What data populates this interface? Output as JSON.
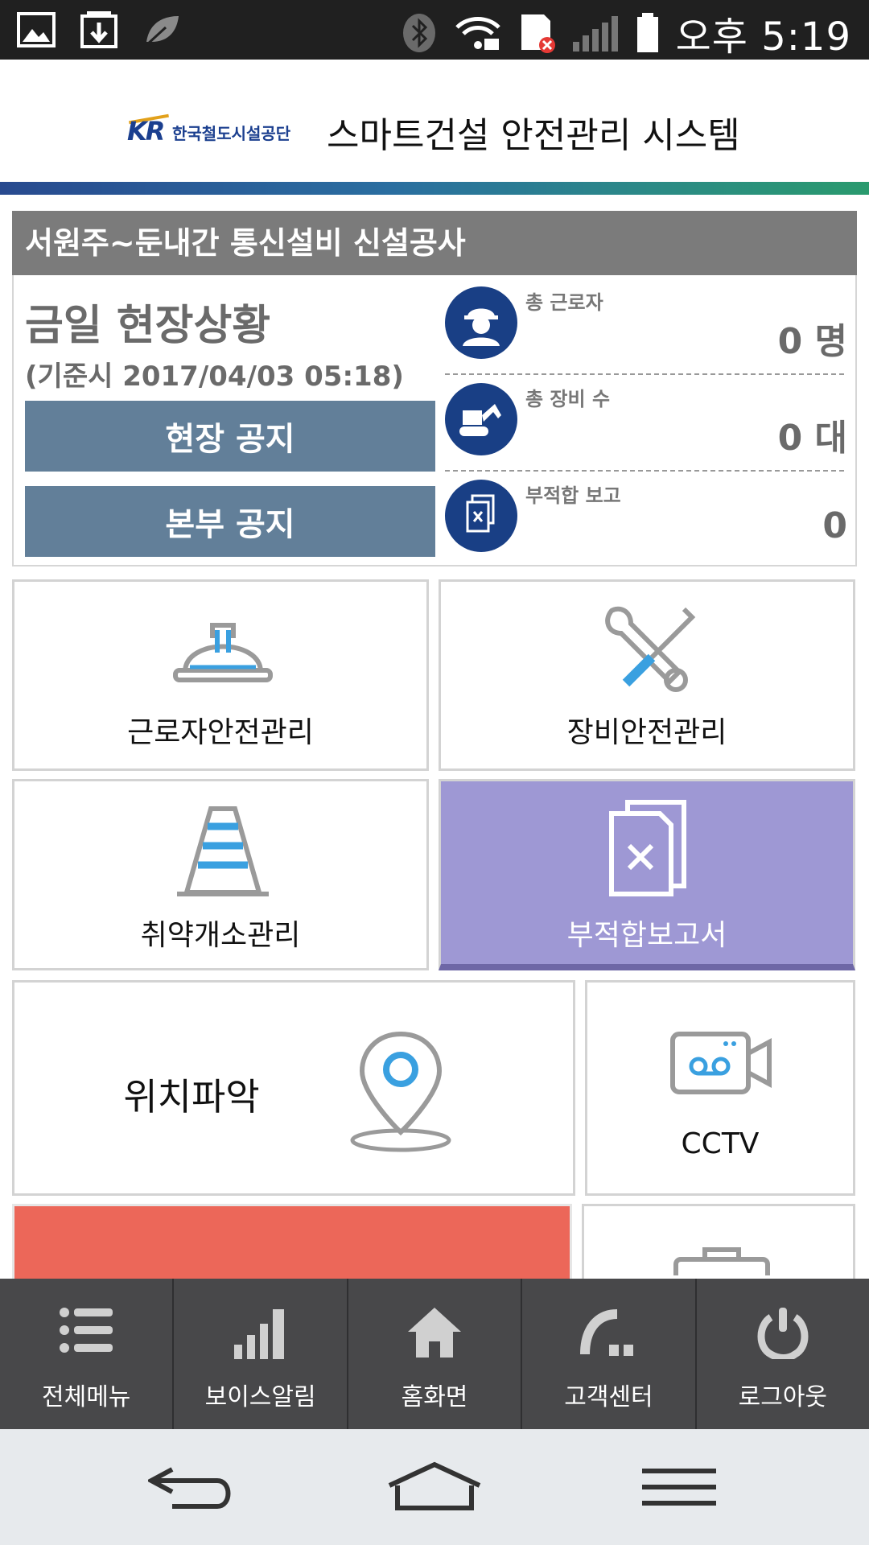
{
  "status_bar": {
    "time": "오후 5:19",
    "icons": [
      "gallery-icon",
      "download-icon",
      "leaf-icon",
      "bluetooth-icon",
      "wifi-lock-icon",
      "sim-error-icon",
      "signal-icon",
      "battery-icon"
    ]
  },
  "header": {
    "logo_text": "한국철도시설공단",
    "logo_mark": "KR",
    "title": "스마트건설 안전관리 시스템"
  },
  "site": {
    "name": "서원주~둔내간 통신설비 신설공사"
  },
  "today": {
    "title": "금일 현장상황",
    "timestamp": "(기준시 2017/04/03 05:18)",
    "site_notice_label": "현장 공지",
    "hq_notice_label": "본부 공지"
  },
  "stats": [
    {
      "label": "총 근로자",
      "value": "0 명",
      "icon": "worker-icon"
    },
    {
      "label": "총 장비 수",
      "value": "0 대",
      "icon": "excavator-icon"
    },
    {
      "label": "부적합 보고",
      "value": "0",
      "icon": "document-x-icon"
    }
  ],
  "tiles": {
    "worker_safety": "근로자안전관리",
    "equipment_safety": "장비안전관리",
    "vulnerable_area": "취약개소관리",
    "nonconformity_report": "부적합보고서",
    "location": "위치파악",
    "cctv": "CCTV"
  },
  "colors": {
    "accent_purple": "#9e98d4",
    "navy": "#193f85",
    "notice_button": "#627f99",
    "red_tile": "#ec6759",
    "nav_bg": "#48484a"
  },
  "bottom_nav": [
    {
      "label": "전체메뉴",
      "icon": "list-icon"
    },
    {
      "label": "보이스알림",
      "icon": "bars-icon"
    },
    {
      "label": "홈화면",
      "icon": "home-icon"
    },
    {
      "label": "고객센터",
      "icon": "headset-icon"
    },
    {
      "label": "로그아웃",
      "icon": "power-icon"
    }
  ]
}
